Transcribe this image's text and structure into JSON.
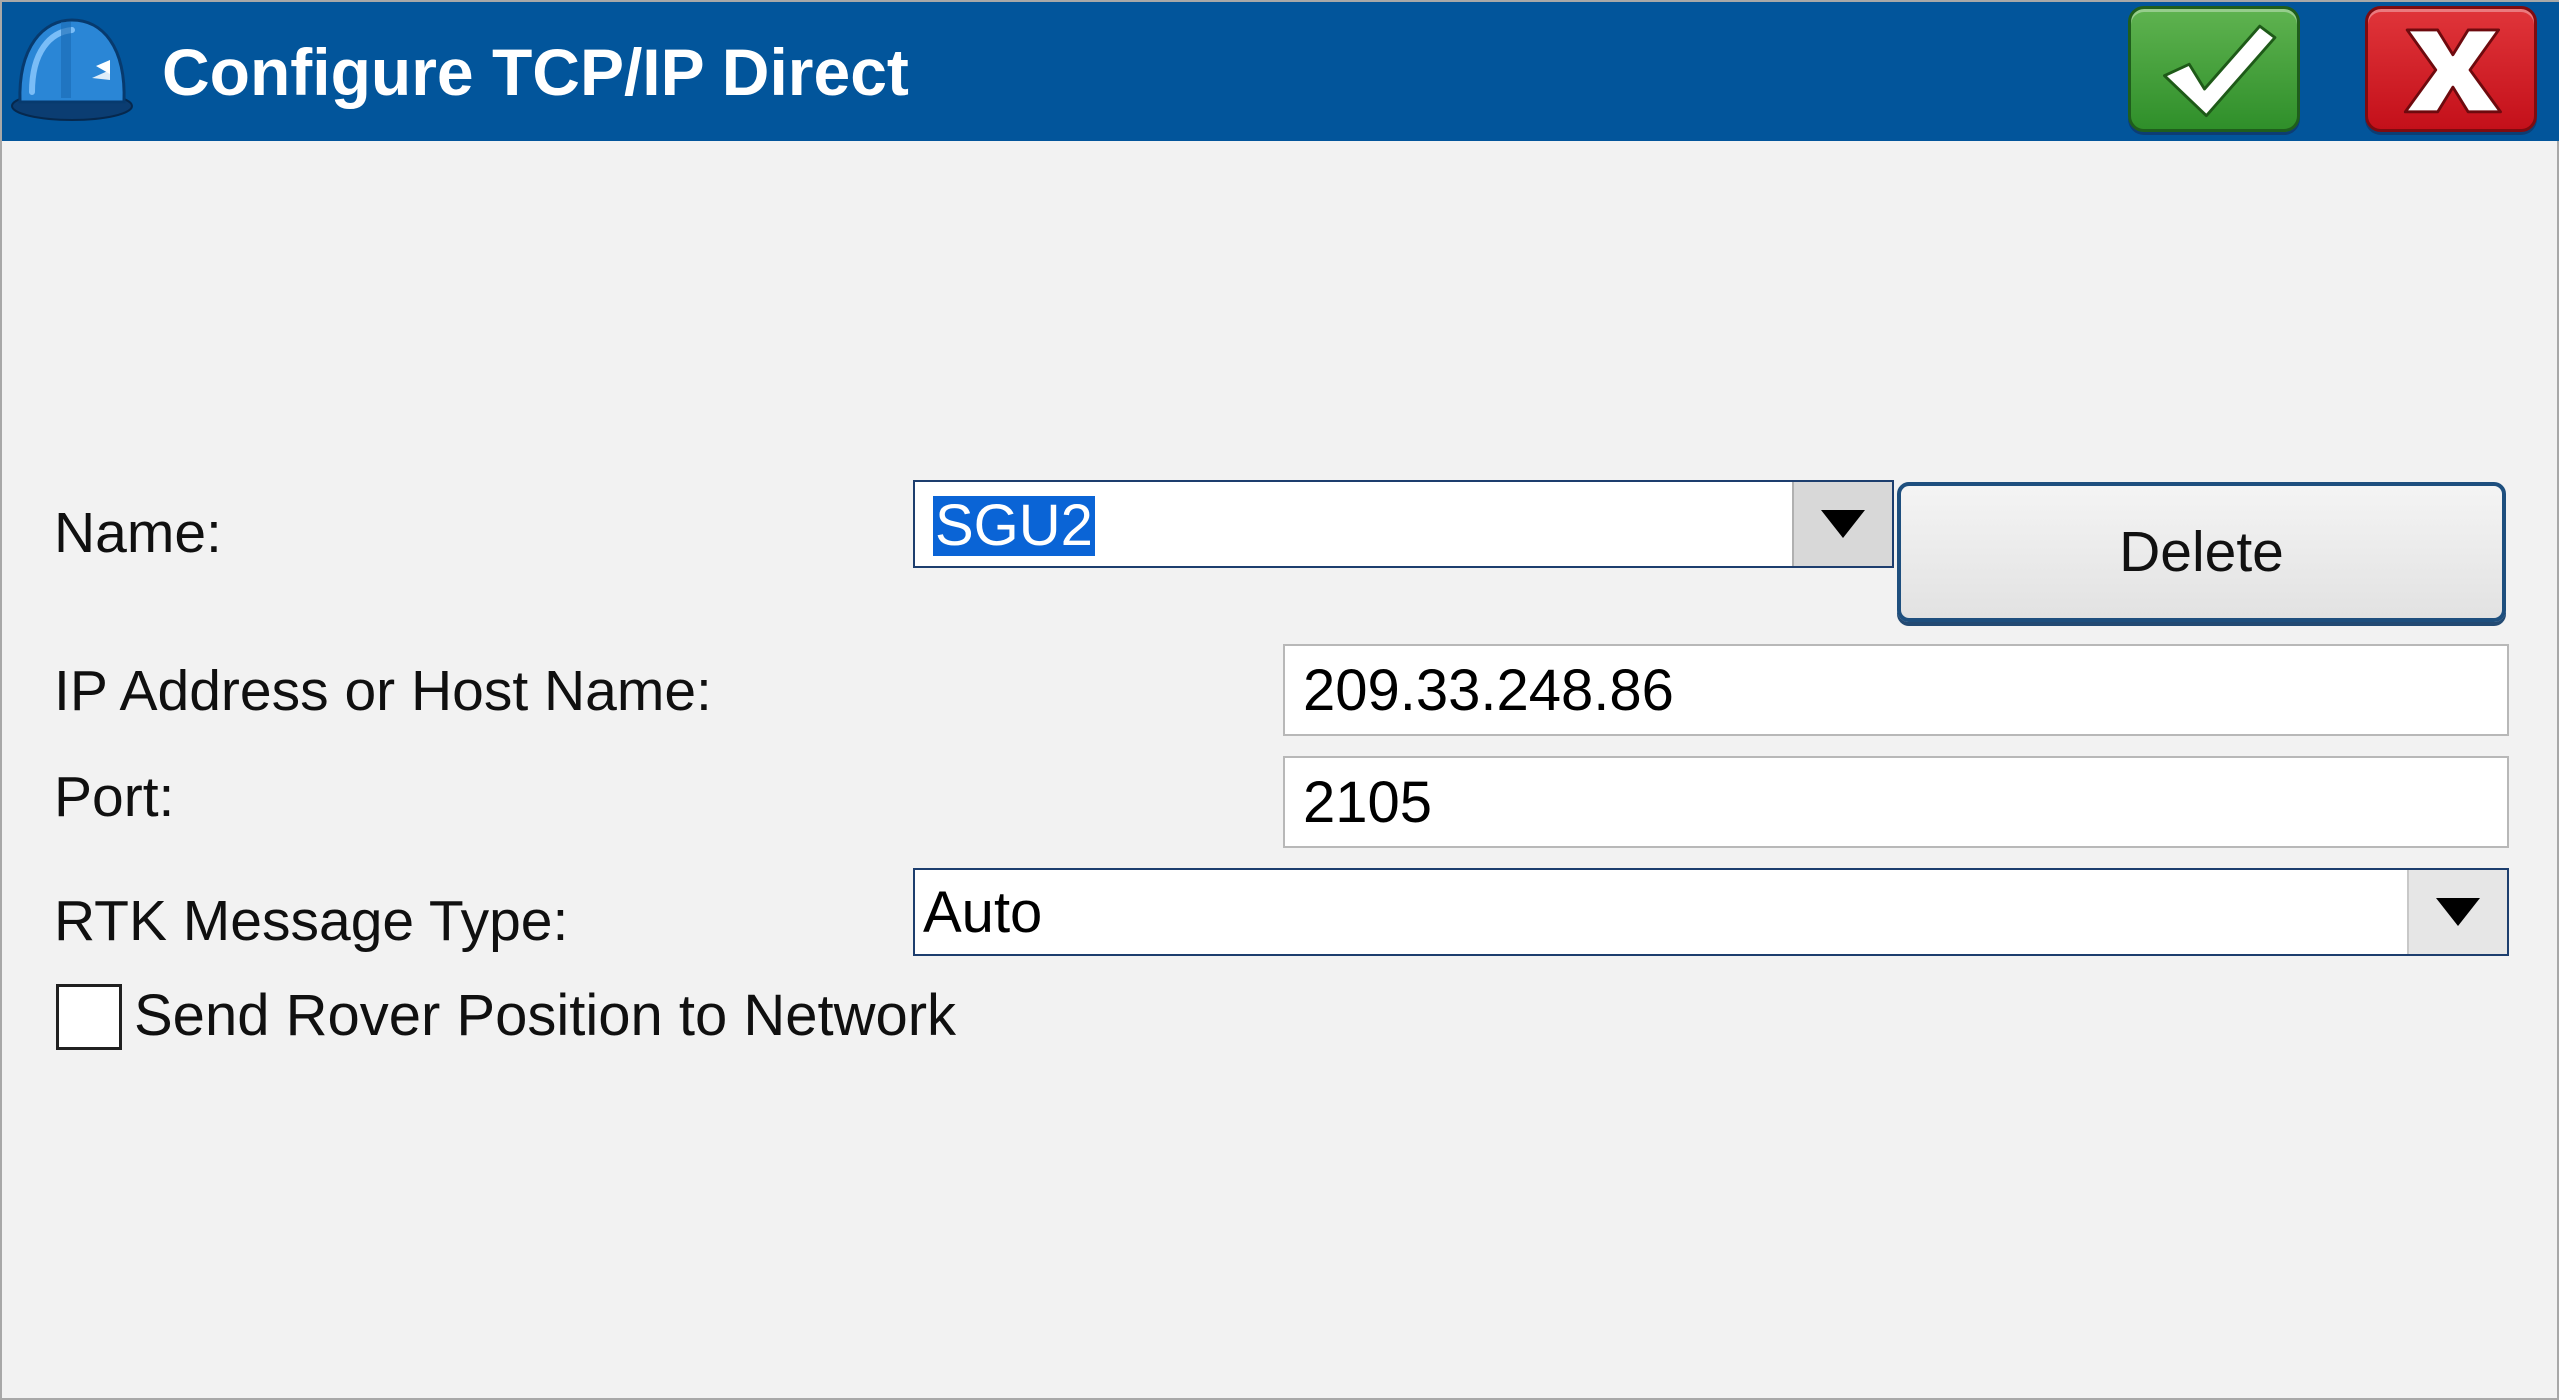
{
  "window": {
    "title": "Configure TCP/IP Direct"
  },
  "icons": {
    "app": "hard-hat-icon",
    "accept": "checkmark-icon",
    "cancel": "close-x-icon",
    "dropdown": "triangle-down-icon"
  },
  "colors": {
    "title_bar": "#02559b",
    "accept_button": "#3f9a35",
    "cancel_button": "#d0161f",
    "selection": "#0a64d6"
  },
  "form": {
    "name": {
      "label": "Name:",
      "value": "SGU2",
      "selected": true
    },
    "delete_button_label": "Delete",
    "ip": {
      "label": "IP Address or Host Name:",
      "value": "209.33.248.86"
    },
    "port": {
      "label": "Port:",
      "value": "2105"
    },
    "rtk_message_type": {
      "label": "RTK Message Type:",
      "value": "Auto"
    },
    "send_rover_position": {
      "label": "Send Rover Position to Network",
      "checked": false
    }
  }
}
